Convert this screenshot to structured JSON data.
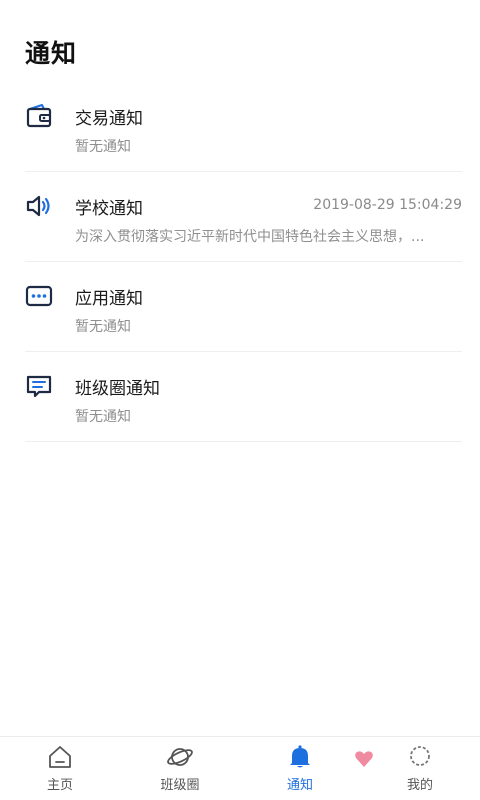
{
  "page": {
    "title": "通知"
  },
  "notifications": [
    {
      "title": "交易通知",
      "time": "",
      "subtitle": "暂无通知",
      "icon": "wallet-icon"
    },
    {
      "title": "学校通知",
      "time": "2019-08-29 15:04:29",
      "subtitle": "为深入贯彻落实习近平新时代中国特色社会主义思想，...",
      "icon": "speaker-icon"
    },
    {
      "title": "应用通知",
      "time": "",
      "subtitle": "暂无通知",
      "icon": "app-dots-icon"
    },
    {
      "title": "班级圈通知",
      "time": "",
      "subtitle": "暂无通知",
      "icon": "message-icon"
    }
  ],
  "tabbar": {
    "tabs": [
      {
        "label": "主页",
        "icon": "home-icon",
        "active": false
      },
      {
        "label": "班级圈",
        "icon": "planet-icon",
        "active": false
      },
      {
        "label": "通知",
        "icon": "bell-icon",
        "active": true
      },
      {
        "label": "我的",
        "icon": "profile-icon",
        "active": false
      }
    ]
  },
  "colors": {
    "accent": "#1e6fe0",
    "icon_dark": "#1f2a44",
    "heart": "#f08aa0"
  }
}
